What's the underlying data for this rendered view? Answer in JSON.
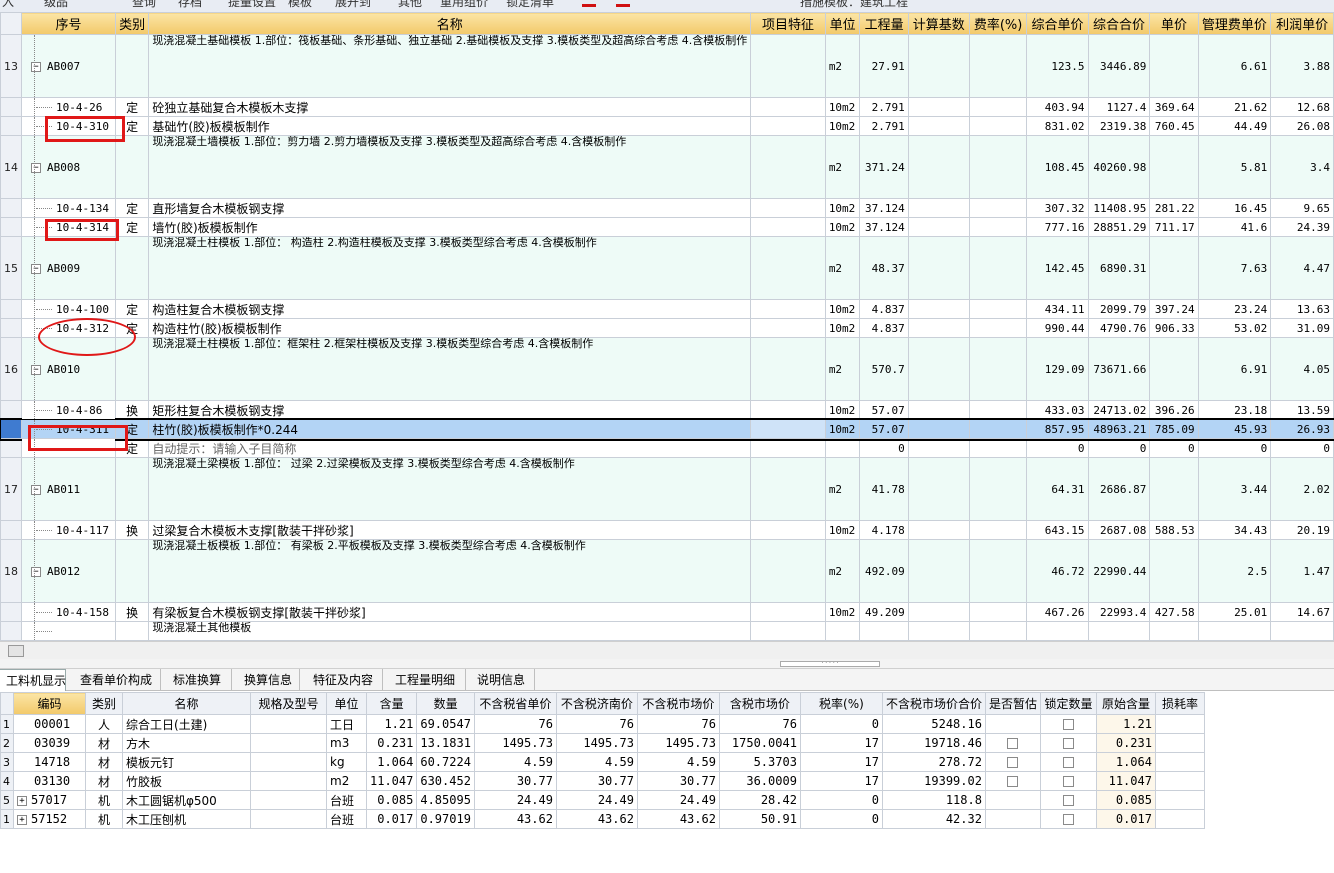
{
  "upper_columns": [
    "序号",
    "类别",
    "名称",
    "项目特征",
    "单位",
    "工程量",
    "计算基数",
    "费率(%)",
    "综合单价",
    "综合合价",
    "单价",
    "管理费单价",
    "利润单价"
  ],
  "rows": [
    {
      "kind": "main",
      "rownum": "13",
      "code": "AB007",
      "cat": "",
      "name": "现浇混凝土基础模板\n1.部位：筏板基础、条形基础、独立基础\n2.基础模板及支撑\n3.模板类型及超高综合考虑\n4.含模板制作",
      "unit": "m2",
      "qty": "27.91",
      "base": "",
      "rate": "",
      "unit_price": "123.5",
      "total": "3446.89",
      "price": "",
      "mgmt": "6.61",
      "profit": "3.88"
    },
    {
      "kind": "sub",
      "rownum": "",
      "code": "10-4-26",
      "cat": "定",
      "name": "砼独立基础复合木模板木支撑",
      "unit": "10m2",
      "qty": "2.791",
      "base": "",
      "rate": "",
      "unit_price": "403.94",
      "total": "1127.4",
      "price": "369.64",
      "mgmt": "21.62",
      "profit": "12.68"
    },
    {
      "kind": "sub",
      "rownum": "",
      "code": "10-4-310",
      "cat": "定",
      "name": "基础竹(胶)板模板制作",
      "unit": "10m2",
      "qty": "2.791",
      "base": "",
      "rate": "",
      "unit_price": "831.02",
      "total": "2319.38",
      "price": "760.45",
      "mgmt": "44.49",
      "profit": "26.08"
    },
    {
      "kind": "main",
      "rownum": "14",
      "code": "AB008",
      "cat": "",
      "name": "现浇混凝土墙模板\n1.部位：剪力墙\n2.剪力墙模板及支撑\n3.模板类型及超高综合考虑\n4.含模板制作",
      "unit": "m2",
      "qty": "371.24",
      "base": "",
      "rate": "",
      "unit_price": "108.45",
      "total": "40260.98",
      "price": "",
      "mgmt": "5.81",
      "profit": "3.4"
    },
    {
      "kind": "sub",
      "rownum": "",
      "code": "10-4-134",
      "cat": "定",
      "name": "直形墙复合木模板钢支撑",
      "unit": "10m2",
      "qty": "37.124",
      "base": "",
      "rate": "",
      "unit_price": "307.32",
      "total": "11408.95",
      "price": "281.22",
      "mgmt": "16.45",
      "profit": "9.65"
    },
    {
      "kind": "sub",
      "rownum": "",
      "code": "10-4-314",
      "cat": "定",
      "name": "墙竹(胶)板模板制作",
      "unit": "10m2",
      "qty": "37.124",
      "base": "",
      "rate": "",
      "unit_price": "777.16",
      "total": "28851.29",
      "price": "711.17",
      "mgmt": "41.6",
      "profit": "24.39"
    },
    {
      "kind": "main",
      "rownum": "15",
      "code": "AB009",
      "cat": "",
      "name": "现浇混凝土柱模板\n1.部位： 构造柱\n2.构造柱模板及支撑\n3.模板类型综合考虑\n4.含模板制作",
      "unit": "m2",
      "qty": "48.37",
      "base": "",
      "rate": "",
      "unit_price": "142.45",
      "total": "6890.31",
      "price": "",
      "mgmt": "7.63",
      "profit": "4.47"
    },
    {
      "kind": "sub",
      "rownum": "",
      "code": "10-4-100",
      "cat": "定",
      "name": "构造柱复合木模板钢支撑",
      "unit": "10m2",
      "qty": "4.837",
      "base": "",
      "rate": "",
      "unit_price": "434.11",
      "total": "2099.79",
      "price": "397.24",
      "mgmt": "23.24",
      "profit": "13.63"
    },
    {
      "kind": "sub",
      "rownum": "",
      "code": "10-4-312",
      "cat": "定",
      "name": "构造柱竹(胶)板模板制作",
      "unit": "10m2",
      "qty": "4.837",
      "base": "",
      "rate": "",
      "unit_price": "990.44",
      "total": "4790.76",
      "price": "906.33",
      "mgmt": "53.02",
      "profit": "31.09"
    },
    {
      "kind": "main",
      "rownum": "16",
      "code": "AB010",
      "cat": "",
      "name": "现浇混凝土柱模板\n1.部位：框架柱\n2.框架柱模板及支撑\n3.模板类型综合考虑\n4.含模板制作",
      "unit": "m2",
      "qty": "570.7",
      "base": "",
      "rate": "",
      "unit_price": "129.09",
      "total": "73671.66",
      "price": "",
      "mgmt": "6.91",
      "profit": "4.05"
    },
    {
      "kind": "sub",
      "rownum": "",
      "code": "10-4-86",
      "cat": "换",
      "name": "矩形柱复合木模板钢支撑",
      "unit": "10m2",
      "qty": "57.07",
      "base": "",
      "rate": "",
      "unit_price": "433.03",
      "total": "24713.02",
      "price": "396.26",
      "mgmt": "23.18",
      "profit": "13.59"
    },
    {
      "kind": "sel",
      "rownum": "",
      "code": "10-4-311",
      "cat": "定",
      "name": "柱竹(胶)板模板制作*0.244",
      "unit": "10m2",
      "qty": "57.07",
      "base": "",
      "rate": "",
      "unit_price": "857.95",
      "total": "48963.21",
      "price": "785.09",
      "mgmt": "45.93",
      "profit": "26.93"
    },
    {
      "kind": "hint",
      "rownum": "",
      "code": "",
      "cat": "定",
      "name": "自动提示：请输入子目简称",
      "unit": "",
      "qty": "0",
      "base": "",
      "rate": "",
      "unit_price": "0",
      "total": "0",
      "price": "0",
      "mgmt": "0",
      "profit": "0"
    },
    {
      "kind": "main",
      "rownum": "17",
      "code": "AB011",
      "cat": "",
      "name": "现浇混凝土梁模板\n1.部位： 过梁\n2.过梁模板及支撑\n3.模板类型综合考虑\n4.含模板制作",
      "unit": "m2",
      "qty": "41.78",
      "base": "",
      "rate": "",
      "unit_price": "64.31",
      "total": "2686.87",
      "price": "",
      "mgmt": "3.44",
      "profit": "2.02"
    },
    {
      "kind": "sub",
      "rownum": "",
      "code": "10-4-117",
      "cat": "换",
      "name": "过梁复合木模板木支撑[散装干拌砂浆]",
      "unit": "10m2",
      "qty": "4.178",
      "base": "",
      "rate": "",
      "unit_price": "643.15",
      "total": "2687.08",
      "price": "588.53",
      "mgmt": "34.43",
      "profit": "20.19"
    },
    {
      "kind": "main",
      "rownum": "18",
      "code": "AB012",
      "cat": "",
      "name": "现浇混凝土板模板\n1.部位： 有梁板\n2.平板模板及支撑\n3.模板类型综合考虑\n4.含模板制作",
      "unit": "m2",
      "qty": "492.09",
      "base": "",
      "rate": "",
      "unit_price": "46.72",
      "total": "22990.44",
      "price": "",
      "mgmt": "2.5",
      "profit": "1.47"
    },
    {
      "kind": "sub",
      "rownum": "",
      "code": "10-4-158",
      "cat": "换",
      "name": "有梁板复合木模板钢支撑[散装干拌砂浆]",
      "unit": "10m2",
      "qty": "49.209",
      "base": "",
      "rate": "",
      "unit_price": "467.26",
      "total": "22993.4",
      "price": "427.58",
      "mgmt": "25.01",
      "profit": "14.67"
    },
    {
      "kind": "partial",
      "rownum": "",
      "code": "",
      "cat": "",
      "name": "现浇混凝土其他模板",
      "unit": "",
      "qty": "",
      "base": "",
      "rate": "",
      "unit_price": "",
      "total": "",
      "price": "",
      "mgmt": "",
      "profit": ""
    }
  ],
  "tabs": [
    "工料机显示",
    "查看单价构成",
    "标准换算",
    "换算信息",
    "特征及内容",
    "工程量明细",
    "说明信息"
  ],
  "lower_columns": [
    "编码",
    "类别",
    "名称",
    "规格及型号",
    "单位",
    "含量",
    "数量",
    "不含税省单价",
    "不含税济南价",
    "不含税市场价",
    "含税市场价",
    "税率(%)",
    "不含税市场价合价",
    "是否暂估",
    "锁定数量",
    "原始含量",
    "损耗率"
  ],
  "materials": [
    {
      "rn": "1",
      "expander": false,
      "code": "00001",
      "cat": "人",
      "name": "综合工日(土建)",
      "spec": "",
      "unit": "工日",
      "content": "1.21",
      "qty": "69.0547",
      "p1": "76",
      "p2": "76",
      "p3": "76",
      "p4": "76",
      "tax": "0",
      "sum": "5248.16",
      "est_cb": false,
      "orig": "1.21",
      "loss": ""
    },
    {
      "rn": "2",
      "expander": false,
      "code": "03039",
      "cat": "材",
      "name": "方木",
      "spec": "",
      "unit": "m3",
      "content": "0.231",
      "qty": "13.1831",
      "p1": "1495.73",
      "p2": "1495.73",
      "p3": "1495.73",
      "p4": "1750.0041",
      "tax": "17",
      "sum": "19718.46",
      "est_cb": true,
      "orig": "0.231",
      "loss": ""
    },
    {
      "rn": "3",
      "expander": false,
      "code": "14718",
      "cat": "材",
      "name": "模板元钉",
      "spec": "",
      "unit": "kg",
      "content": "1.064",
      "qty": "60.7224",
      "p1": "4.59",
      "p2": "4.59",
      "p3": "4.59",
      "p4": "5.3703",
      "tax": "17",
      "sum": "278.72",
      "est_cb": true,
      "orig": "1.064",
      "loss": ""
    },
    {
      "rn": "4",
      "expander": false,
      "code": "03130",
      "cat": "材",
      "name": "竹胶板",
      "spec": "",
      "unit": "m2",
      "content": "11.047",
      "qty": "630.452",
      "p1": "30.77",
      "p2": "30.77",
      "p3": "30.77",
      "p4": "36.0009",
      "tax": "17",
      "sum": "19399.02",
      "est_cb": true,
      "orig": "11.047",
      "loss": ""
    },
    {
      "rn": "5",
      "expander": true,
      "code": "57017",
      "cat": "机",
      "name": "木工圆锯机φ500",
      "spec": "",
      "unit": "台班",
      "content": "0.085",
      "qty": "4.85095",
      "p1": "24.49",
      "p2": "24.49",
      "p3": "24.49",
      "p4": "28.42",
      "tax": "0",
      "sum": "118.8",
      "est_cb": false,
      "orig": "0.085",
      "loss": ""
    },
    {
      "rn": "1",
      "expander": true,
      "code": "57152",
      "cat": "机",
      "name": "木工压刨机",
      "spec": "",
      "unit": "台班",
      "content": "0.017",
      "qty": "0.97019",
      "p1": "43.62",
      "p2": "43.62",
      "p3": "43.62",
      "p4": "50.91",
      "tax": "0",
      "sum": "42.32",
      "est_cb": false,
      "orig": "0.017",
      "loss": ""
    }
  ],
  "colors": {
    "header": "#f2c96a",
    "selected_row": "#b3d4f5",
    "main_row": "#eefbf7",
    "annotation": "#e01818"
  }
}
